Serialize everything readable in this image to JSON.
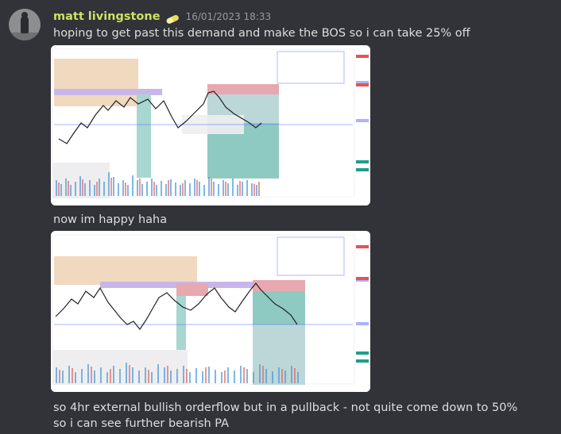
{
  "message": {
    "username": "matt livingstone",
    "timestamp": "16/01/2023 18:33",
    "avatar_icon": "avatar-image",
    "badge_icon": "pill-badge-icon",
    "username_color": "#c9e264",
    "lines": [
      "hoping to get past this demand and make the BOS so i can take 25% off",
      "now im happy haha",
      "so 4hr external bullish orderflow but in a pullback - not quite come down to 50% so i can see further bearish PA"
    ]
  },
  "attachments": [
    {
      "type": "image",
      "description_icon": "tradingview-chart-image"
    },
    {
      "type": "image",
      "description_icon": "tradingview-chart-image"
    }
  ]
}
